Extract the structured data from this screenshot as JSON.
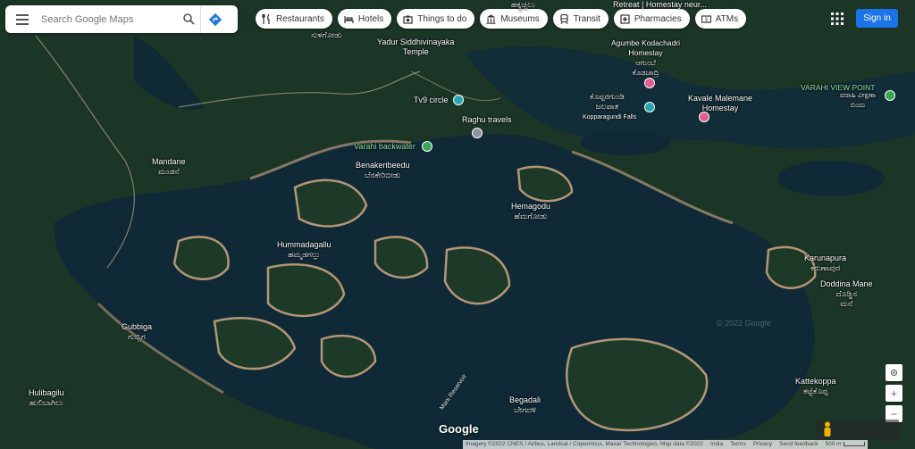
{
  "search": {
    "placeholder": "Search Google Maps"
  },
  "chips": [
    {
      "label": "Restaurants",
      "icon": "restaurant-icon"
    },
    {
      "label": "Hotels",
      "icon": "hotel-icon"
    },
    {
      "label": "Things to do",
      "icon": "camera-icon"
    },
    {
      "label": "Museums",
      "icon": "museum-icon"
    },
    {
      "label": "Transit",
      "icon": "transit-icon"
    },
    {
      "label": "Pharmacies",
      "icon": "pharmacy-icon"
    },
    {
      "label": "ATMs",
      "icon": "atm-icon"
    }
  ],
  "signin": "Sign in",
  "places": {
    "top_partial_1": "ಸುಳಗೋಡು",
    "top_partial_2": "ಹಕ್ಕ್ಲಚ್ಚಲು",
    "top_partial_3": "Retreat | Homestay neur...",
    "yadur": "Yadur Siddhivinayaka\nTemple",
    "agumbe": "Agumbe Kodachadri\nHomestay\nಆಗುಂಬೆ\nಕೊಡಚಾದ್ರಿ",
    "tv9": "Tv9 circle",
    "raghu": "Raghu travels",
    "koppar": "ಕೊಪ್ಪರಗುಂಡಿ\nಜಲಪಾತ",
    "koppar_en": "Kopparagundi Falls",
    "kavale": "Kavale Malemane\nHomestay",
    "varahi_vp": "VARAHI VIEW POINT",
    "varahi_vp_kn": "ವರಾಹಿ ವೀಕ್ಷಣಾ\nಬಿಂದು",
    "varahi_bw": "Varahi backwater",
    "mandane": "Mandane\nಮಂಡನೆ",
    "benakeribeedu": "Benakeribeedu\nಬೆನಕೇರಿಬೀಡು",
    "hemagodu": "Hemagodu\nಹೆಮಗೋಡು",
    "hummadagallu": "Hummadagallu\nಹಮ್ಮಡಗಲ್ಲು",
    "karunapura": "Karunapura\nಕರುಣಾಪುರ",
    "doddina": "Doddina Mane\nದೊಡ್ಡಿನ\nಮನೆ",
    "gubbiga": "Gubbiga\nಗುಬ್ಬಿಗ",
    "kattekoppa": "Kattekoppa\nಕಟ್ಟೆಕೊಪ್ಪ",
    "hulibagilu": "Hulibagilu\nಹುಲಿಬಾಗಿಲು",
    "begadali": "Begadali\nಬೇಗದಳಿ",
    "reservoir": "Mani Reservoir",
    "faint": "© 2022 Google"
  },
  "logo": "Google",
  "attribution": {
    "imagery": "Imagery ©2022 CNES / Airbus, Landsat / Copernicus, Maxar Technologies, Map data ©2022",
    "india": "India",
    "terms": "Terms",
    "privacy": "Privacy",
    "feedback": "Send feedback",
    "scale": "500 m"
  },
  "controls": {
    "zoom_in": "+",
    "zoom_out": "−"
  }
}
